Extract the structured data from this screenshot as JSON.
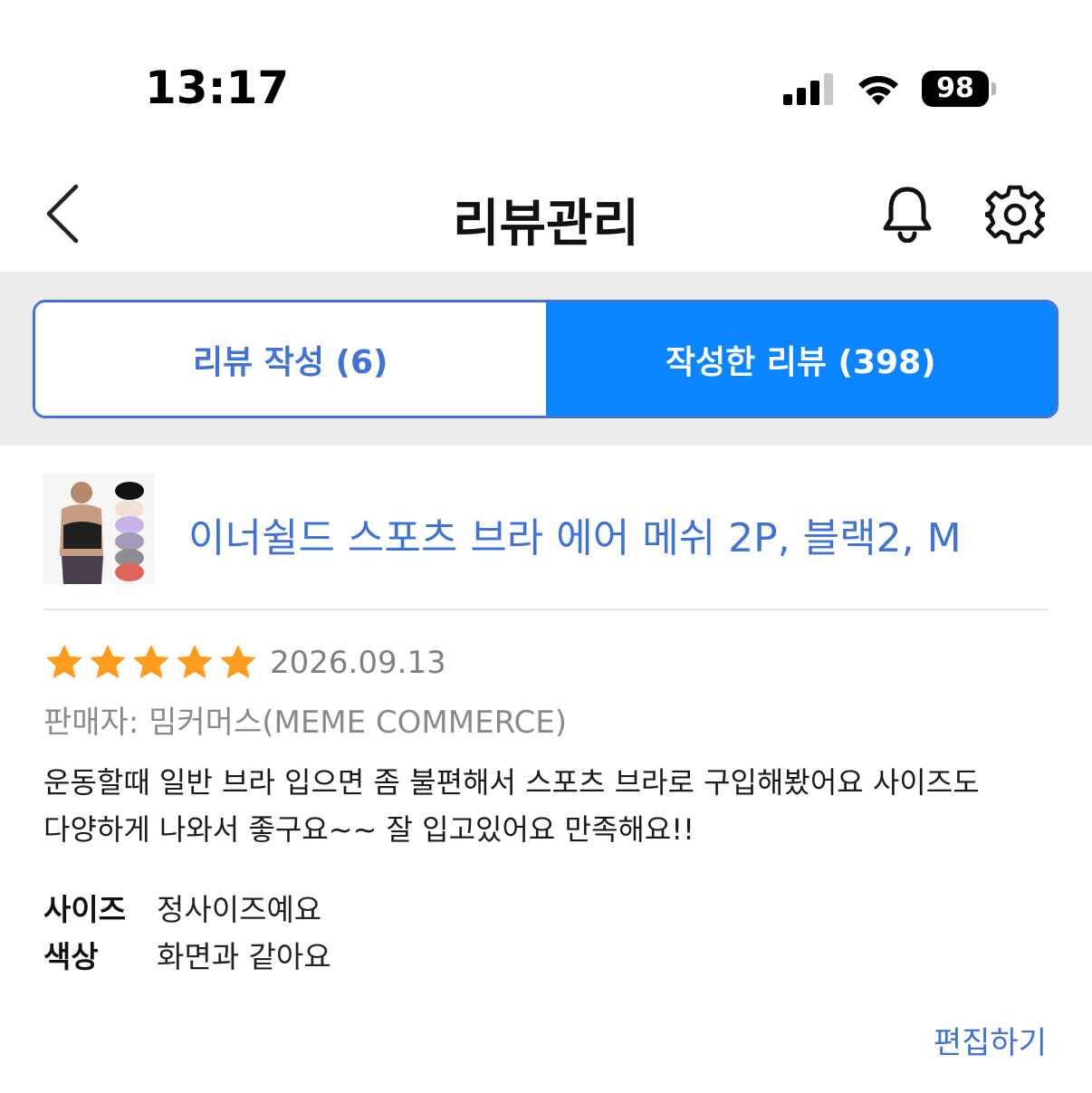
{
  "status_bar": {
    "time": "13:17",
    "battery_level": "98",
    "icons": [
      "cellular-signal-icon",
      "wifi-icon",
      "battery-icon"
    ]
  },
  "header": {
    "title": "리뷰관리",
    "icons": [
      "chevron-left-icon",
      "bell-icon",
      "gear-icon"
    ]
  },
  "tabs": [
    {
      "label": "리뷰 작성 (6)",
      "active": false
    },
    {
      "label": "작성한 리뷰 (398)",
      "active": true
    }
  ],
  "review": {
    "product_name": "이너쉴드 스포츠 브라 에어 메쉬 2P, 블랙2, M",
    "rating": 5,
    "rating_max": 5,
    "date": "2026.09.13",
    "seller": "판매자: 밈커머스(MEME COMMERCE)",
    "body_lines": [
      "운동할때 일반 브라 입으면 좀 불편해서 스포츠 브라로 구입해봤어요 사이즈도",
      "다양하게 나와서 좋구요~~ 잘 입고있어요 만족해요!!"
    ],
    "attributes": [
      {
        "label": "사이즈",
        "value": "정사이즈예요"
      },
      {
        "label": "색상",
        "value": "화면과 같아요"
      }
    ],
    "edit_label": "편집하기"
  },
  "colors": {
    "accent_blue": "#3f73d8",
    "active_tab_blue": "#0a84ff",
    "star_orange": "#ff9a1f",
    "band_gray": "#ececec"
  }
}
